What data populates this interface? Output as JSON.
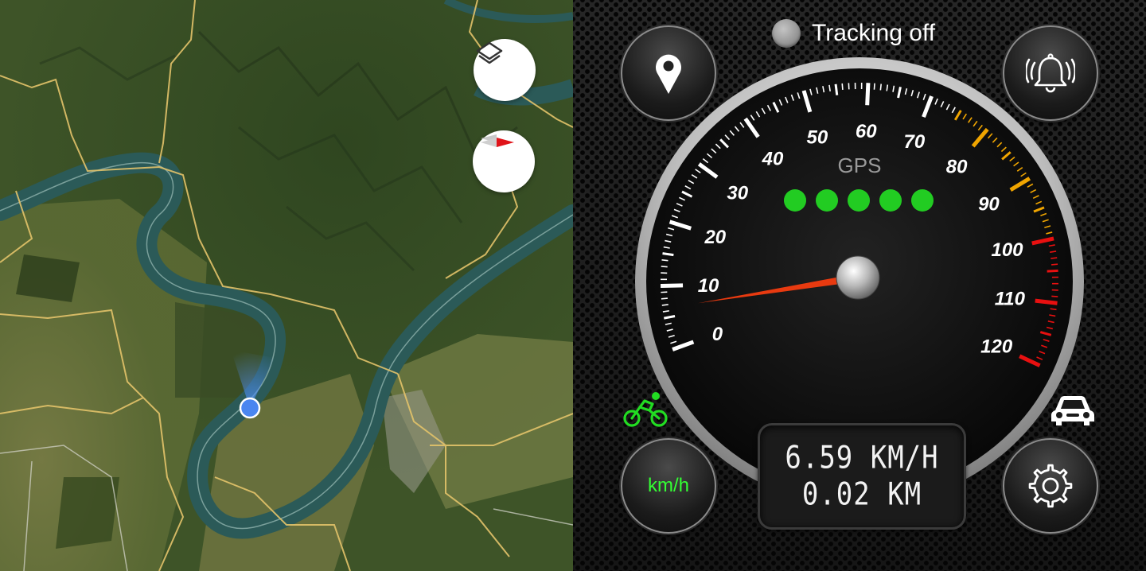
{
  "map": {
    "layers_button": "layers-icon",
    "compass_button": "compass-icon",
    "location_marker": "current-location-dot"
  },
  "tracking": {
    "label": "Tracking off",
    "state": "off"
  },
  "buttons": {
    "location": "map-pin-icon",
    "alarm": "alarm-bell-icon",
    "units_label": "km/h",
    "settings": "gear-icon"
  },
  "gauge": {
    "gps_label": "GPS",
    "gps_signal_dots": 5,
    "gps_dot_color": "#22cc22",
    "speed_labels": [
      "0",
      "10",
      "20",
      "30",
      "40",
      "50",
      "60",
      "70",
      "80",
      "90",
      "100",
      "110",
      "120"
    ],
    "min": 0,
    "max": 120,
    "needle_value": 6.59,
    "colors": {
      "normal": "#ffffff",
      "warning": "#f0a500",
      "danger": "#e81010",
      "needle": "#e83a10"
    }
  },
  "readout": {
    "speed": "6.59 KM/H",
    "distance": "0.02 KM"
  },
  "mode_icons": {
    "left": "bicycle-icon",
    "left_color": "#22dd22",
    "right": "car-icon"
  }
}
